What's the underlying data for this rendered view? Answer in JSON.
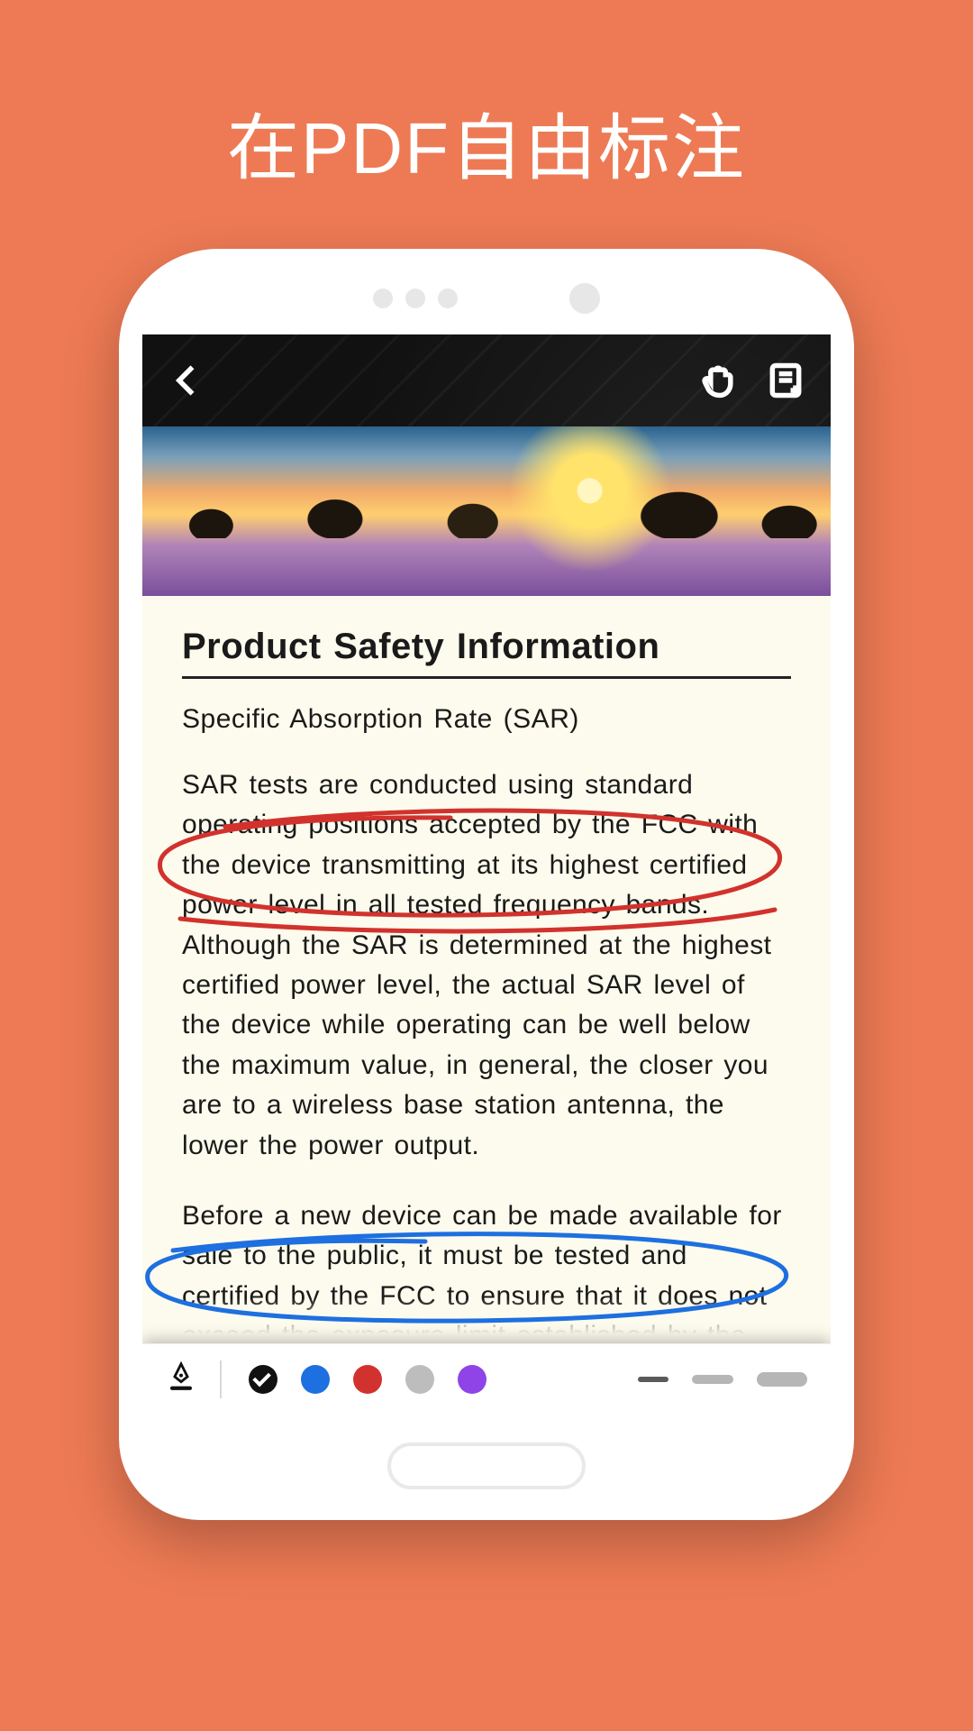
{
  "hero_title": "在PDF自由标注",
  "navbar": {
    "icons": {
      "back": "chevron-left-icon",
      "hand": "hand-icon",
      "note_add": "note-add-icon"
    }
  },
  "document": {
    "title": "Product Safety Information",
    "subhead": "Specific Absorption Rate (SAR)",
    "paragraph1": "SAR tests are conducted using standard operating positions accepted by the FCC with the device transmitting at its highest certified power level in all tested frequency bands. Although the SAR is determined at the highest certified power level, the actual SAR level of the device while operating can be well below the maximum value, in general, the closer you are to a wireless base station antenna, the lower the power output.",
    "paragraph2": "Before a new device can be made available for sale to the public, it must be tested and certified by the FCC to ensure that it does not exceed the exposure limit established by the FCC. Tests for each device are performed in positions and locations as required by the FCC.",
    "annotations": [
      {
        "id": "anno-red",
        "shape": "ellipse",
        "color": "#d2322d"
      },
      {
        "id": "anno-blue",
        "shape": "ellipse",
        "color": "#1e6fe0"
      }
    ]
  },
  "toolbar": {
    "tool": "pen-icon",
    "colors": [
      {
        "name": "black",
        "hex": "#111111",
        "selected": true
      },
      {
        "name": "blue",
        "hex": "#1e6fe0",
        "selected": false
      },
      {
        "name": "red",
        "hex": "#d2322d",
        "selected": false
      },
      {
        "name": "gray",
        "hex": "#bdbdbd",
        "selected": false
      },
      {
        "name": "purple",
        "hex": "#8e44e6",
        "selected": false
      }
    ],
    "strokes": [
      "thin",
      "medium",
      "thick"
    ]
  }
}
